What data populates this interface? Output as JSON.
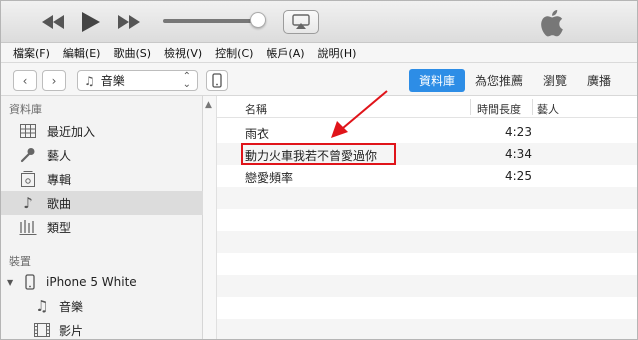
{
  "menu": [
    "檔案(F)",
    "編輯(E)",
    "歌曲(S)",
    "檢視(V)",
    "控制(C)",
    "帳戶(A)",
    "說明(H)"
  ],
  "toolbar": {
    "media_label": "音樂",
    "tabs": [
      "資料庫",
      "為您推薦",
      "瀏覽",
      "廣播"
    ],
    "active_tab": "資料庫"
  },
  "sidebar": {
    "library_heading": "資料庫",
    "library_items": [
      {
        "label": "最近加入",
        "icon": "grid-icon"
      },
      {
        "label": "藝人",
        "icon": "microphone-icon"
      },
      {
        "label": "專輯",
        "icon": "album-icon"
      },
      {
        "label": "歌曲",
        "icon": "music-note-icon"
      },
      {
        "label": "類型",
        "icon": "genre-icon"
      }
    ],
    "selected_item": "歌曲",
    "devices_heading": "裝置",
    "device_name": "iPhone 5 White",
    "device_items": [
      {
        "label": "音樂",
        "icon": "music-note-icon"
      },
      {
        "label": "影片",
        "icon": "film-icon"
      }
    ]
  },
  "table": {
    "columns": {
      "name": "名稱",
      "time": "時間長度",
      "artist": "藝人"
    },
    "rows": [
      {
        "name": "雨衣",
        "time": "4:23",
        "artist": ""
      },
      {
        "name": "動力火車我若不曾愛過你",
        "time": "4:34",
        "artist": ""
      },
      {
        "name": "戀愛頻率",
        "time": "4:25",
        "artist": ""
      }
    ]
  },
  "colors": {
    "accent": "#2d8de6",
    "annotation": "#e0141a"
  }
}
